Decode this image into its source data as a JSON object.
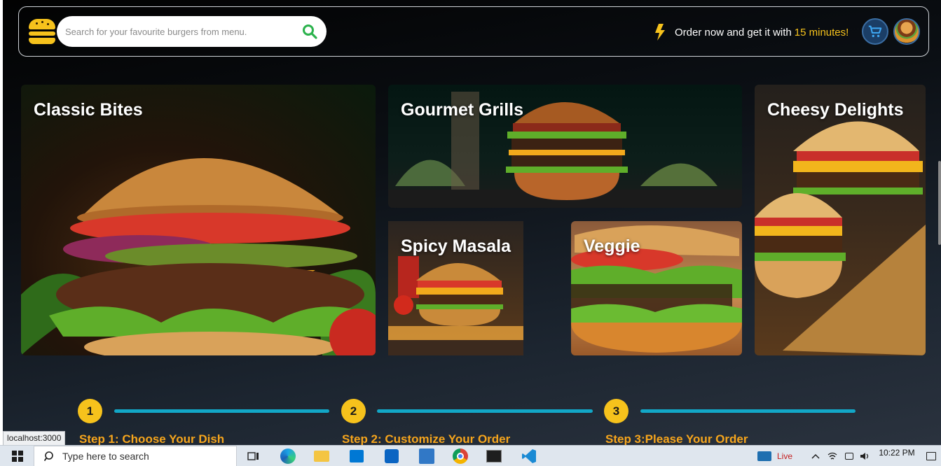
{
  "header": {
    "search_placeholder": "Search for your favourite burgers from menu.",
    "promo_text": "Order now and get it with",
    "promo_highlight": "15 minutes!",
    "logo_icon": "burger-logo-icon",
    "cart_icon": "cart-icon"
  },
  "categories": [
    {
      "title": "Classic Bites"
    },
    {
      "title": "Gourmet Grills"
    },
    {
      "title": "Spicy Masala"
    },
    {
      "title": "Veggie"
    },
    {
      "title": "Cheesy Delights"
    }
  ],
  "steps": [
    {
      "number": "1",
      "label": "Step 1: Choose Your Dish"
    },
    {
      "number": "2",
      "label": "Step 2: Customize Your Order"
    },
    {
      "number": "3",
      "label": "Step 3:Please Your Order"
    }
  ],
  "status_url": "localhost:3000",
  "taskbar": {
    "search_text": "Type here to search",
    "live_label": "Live",
    "time": "10:22 PM"
  },
  "colors": {
    "accent_yellow": "#f6c21c",
    "step_line": "#12a7c7",
    "step_label": "#f6a51c"
  }
}
